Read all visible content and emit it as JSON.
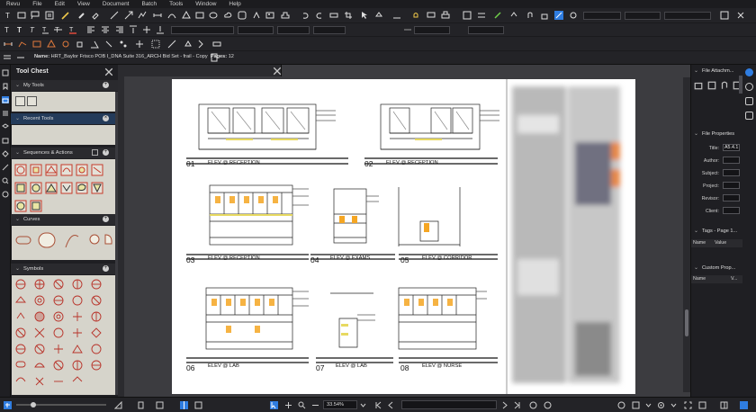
{
  "menu": {
    "items": [
      "Revu",
      "File",
      "Edit",
      "View",
      "Document",
      "Batch",
      "Tools",
      "Window",
      "Help"
    ]
  },
  "doc": {
    "name_label": "Name:",
    "name": "HRT_Baylor Frisco POB I_DNA Suite 316_ARCH Bid Set - frail - Copy",
    "pages_label": "Pages:",
    "pages": "12"
  },
  "tool_chest": {
    "title": "Tool Chest",
    "sections": [
      "My Tools",
      "Recent Tools",
      "Sequences & Actions",
      "Curves",
      "Symbols"
    ]
  },
  "drawing": {
    "details": [
      {
        "num": "01",
        "title": "ELEV @ RECEPTION"
      },
      {
        "num": "02",
        "title": "ELEV @ RECEPTION"
      },
      {
        "num": "03",
        "title": "ELEV @ RECEPTION"
      },
      {
        "num": "04",
        "title": "ELEV @ EXAMS"
      },
      {
        "num": "05",
        "title": "ELEV @ CORRIDOR"
      },
      {
        "num": "06",
        "title": "ELEV @ LAB"
      },
      {
        "num": "07",
        "title": "ELEV @ LAB"
      },
      {
        "num": "08",
        "title": "ELEV @ NURSE"
      }
    ]
  },
  "right_panel": {
    "attachments_title": "File Attachm...",
    "properties_title": "File Properties",
    "fields": [
      {
        "label": "Title:",
        "value": "A5.4.1"
      },
      {
        "label": "Author:",
        "value": ""
      },
      {
        "label": "Subject:",
        "value": ""
      },
      {
        "label": "Project:",
        "value": ""
      },
      {
        "label": "Revisor:",
        "value": ""
      },
      {
        "label": "Client:",
        "value": ""
      }
    ],
    "tags_title": "Tags - Page 1...",
    "tags_col_name": "Name",
    "tags_col_value": "Value",
    "custom_title": "Custom Prop...",
    "custom_col_name": "Name",
    "custom_col_value": "V..."
  },
  "status": {
    "zoom": "33.54%"
  },
  "colors": {
    "accent": "#2f7de1",
    "panel_bg": "#1f1f23",
    "tool_panel": "#d6d4cb"
  },
  "icons": {
    "title_block": "blurred-title-block"
  }
}
